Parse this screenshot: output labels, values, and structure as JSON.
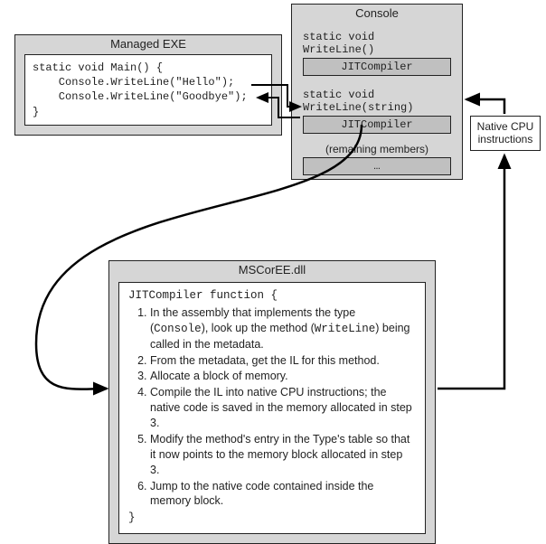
{
  "managed_exe": {
    "title": "Managed EXE",
    "code": "static void Main() {\n    Console.WriteLine(\"Hello\");\n    Console.WriteLine(\"Goodbye\");\n}"
  },
  "console": {
    "title": "Console",
    "method1_label": "static void WriteLine()",
    "method1_slot": "JITCompiler",
    "method2_label": "static void WriteLine(string)",
    "method2_slot": "JITCompiler",
    "remaining_label": "(remaining members)",
    "remaining_slot": "…"
  },
  "native_box": {
    "line1": "Native CPU",
    "line2": "instructions"
  },
  "mscoree": {
    "title": "MSCorEE.dll",
    "func_open": "JITCompiler function {",
    "steps": [
      "In the assembly that implements the type (Console), look up the method (WriteLine) being called in the metadata.",
      "From the metadata, get the IL for this method.",
      "Allocate a block of memory.",
      "Compile the IL into native CPU instructions; the native code is saved in the memory allocated in step 3.",
      "Modify the method's entry in the Type's table so that it now points to the memory block allocated in step 3.",
      "Jump to the native code contained inside the memory block."
    ],
    "func_close": "}"
  }
}
